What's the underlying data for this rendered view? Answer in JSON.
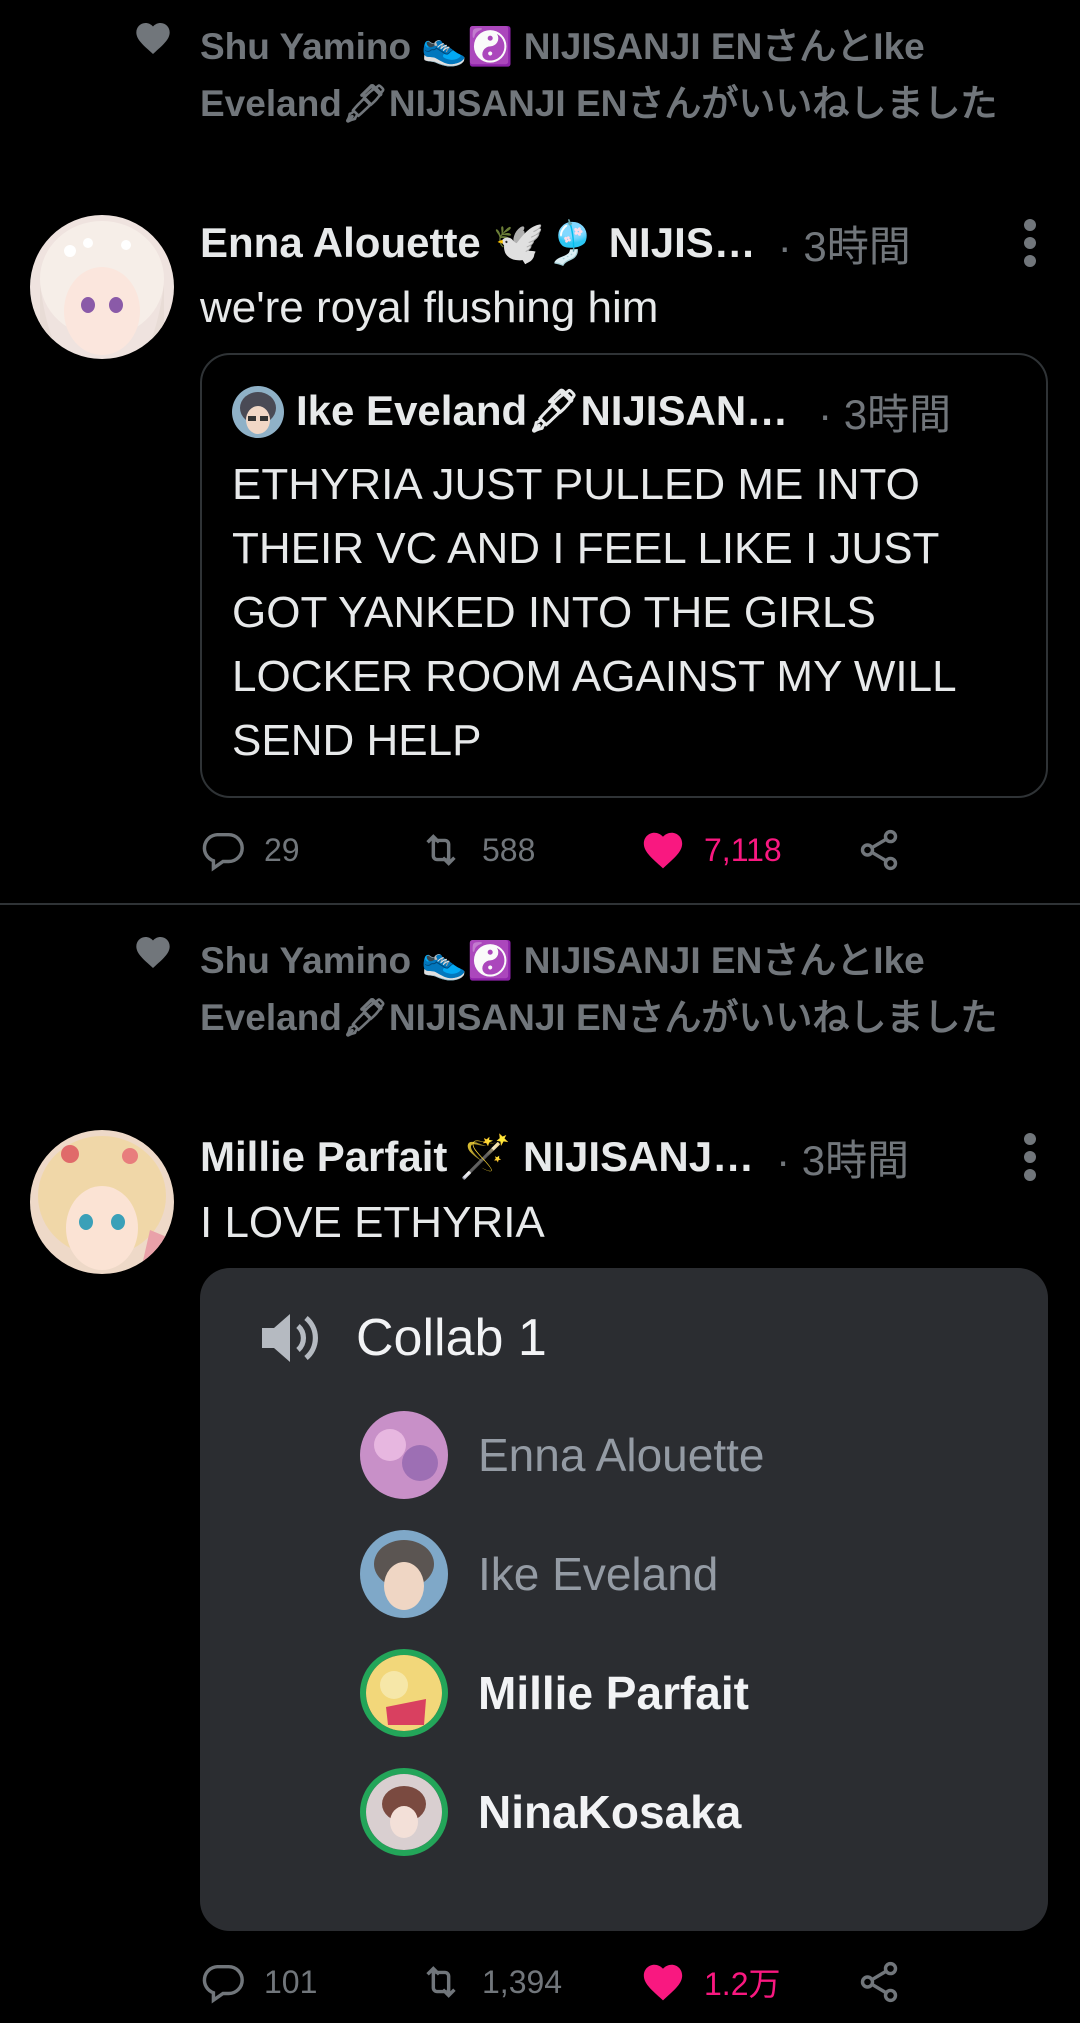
{
  "colors": {
    "like": "#f91880",
    "muted": "#71767b",
    "text": "#e7e9ea",
    "discord_bg": "#2b2d31",
    "speaking": "#23a559"
  },
  "tweets": [
    {
      "social_context": "Shu Yamino 👟☯️ NIJISANJI ENさんとIke Eveland🖋NIJISANJI ENさんがいいねしました",
      "author": "Enna Alouette 🕊️🎐 NIJIS…",
      "time": "· 3時間",
      "text": "we're royal flushing him",
      "quote": {
        "author": "Ike Eveland🖋NIJISAN…",
        "time": "· 3時間",
        "text": "ETHYRIA JUST PULLED ME INTO THEIR VC AND I FEEL LIKE I JUST GOT YANKED INTO THE GIRLS LOCKER ROOM AGAINST MY WILL SEND HELP"
      },
      "replies": "29",
      "retweets": "588",
      "likes": "7,118"
    },
    {
      "social_context": "Shu Yamino 👟☯️ NIJISANJI ENさんとIke Eveland🖋NIJISANJI ENさんがいいねしました",
      "author": "Millie Parfait 🪄 NIJISANJ…",
      "time": "· 3時間",
      "text": "I LOVE ETHYRIA",
      "media": {
        "channel": "Collab 1",
        "members": [
          "Enna Alouette",
          "Ike Eveland",
          "Millie Parfait",
          "NinaKosaka"
        ]
      },
      "replies": "101",
      "retweets": "1,394",
      "likes": "1.2万"
    }
  ],
  "icons": [
    "heart-icon",
    "more-icon",
    "reply-icon",
    "retweet-icon",
    "like-icon",
    "share-icon",
    "speaker-icon"
  ]
}
